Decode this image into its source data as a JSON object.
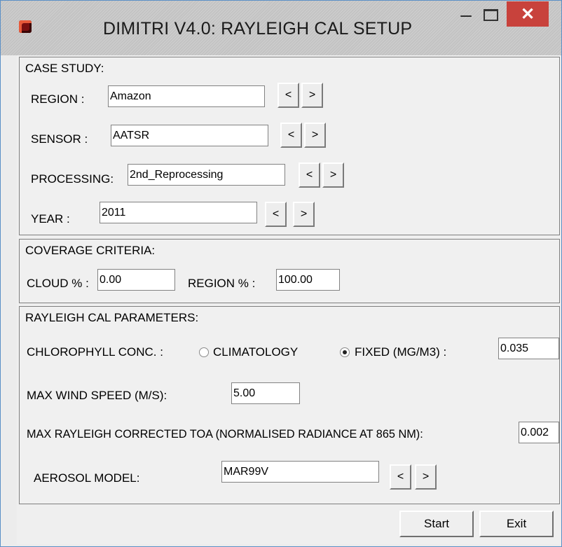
{
  "window": {
    "title": "DIMITRI V4.0: RAYLEIGH CAL SETUP",
    "minimize": "–",
    "close": "✕"
  },
  "case_study": {
    "heading": "CASE STUDY:",
    "region": {
      "label": "REGION   :",
      "value": "Amazon"
    },
    "sensor": {
      "label": "SENSOR   :",
      "value": "AATSR"
    },
    "processing": {
      "label": "PROCESSING:",
      "value": "2nd_Reprocessing"
    },
    "year": {
      "label": "YEAR     :",
      "value": "2011"
    },
    "prev": "<",
    "next": ">"
  },
  "coverage": {
    "heading": "COVERAGE CRITERIA:",
    "cloud": {
      "label": "CLOUD %  :",
      "value": "0.00"
    },
    "region": {
      "label": "REGION %  :",
      "value": "100.00"
    }
  },
  "rayleigh": {
    "heading": "RAYLEIGH CAL PARAMETERS:",
    "chlorophyll": {
      "label": "CHLOROPHYLL CONC.  :",
      "climatology": "CLIMATOLOGY",
      "fixed": "FIXED (MG/M3) :",
      "selected": "fixed",
      "value": "0.035"
    },
    "wind": {
      "label": "MAX WIND SPEED (M/S):",
      "value": "5.00"
    },
    "toa": {
      "label": "MAX RAYLEIGH CORRECTED TOA (NORMALISED RADIANCE AT 865 NM):",
      "value": "0.002"
    },
    "aerosol": {
      "label": "AEROSOL MODEL:",
      "value": "MAR99V"
    }
  },
  "actions": {
    "start": "Start",
    "exit": "Exit"
  },
  "colors": {
    "close_button": "#c8423c",
    "window_border": "#5a8fc6"
  }
}
